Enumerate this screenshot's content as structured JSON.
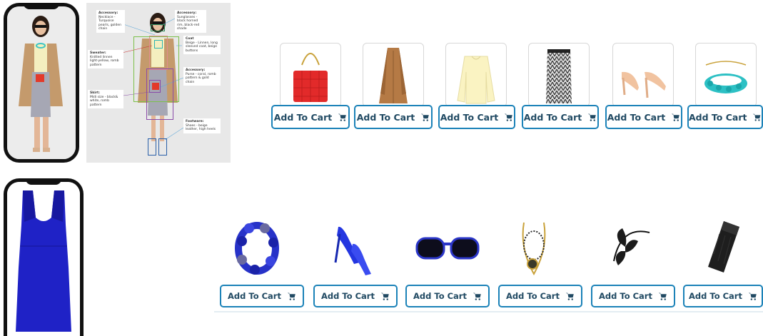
{
  "annotations": {
    "accessory_necklace": {
      "title": "Accessory:",
      "text": "Necklace - Turquoise pearls, golden chain"
    },
    "accessory_sunglasses": {
      "title": "Accessory:",
      "text": "Sunglasses - black horned rim, black-red shade"
    },
    "sweater": {
      "title": "Sweater:",
      "text": "Knitted linnen light-yellow, romb pattern"
    },
    "coat": {
      "title": "Coat",
      "text": "Beige - Linnen, long sleeved coat, beige buttons"
    },
    "accessory_purse": {
      "title": "Accessory:",
      "text": "Purse - coral, romb pattern & gold chain"
    },
    "skirt": {
      "title": "Skirt:",
      "text": "Midi size - black& white, romb pattern"
    },
    "footware": {
      "title": "Footware:",
      "text": "Shoes - beige leather, high heels"
    }
  },
  "row1": {
    "products": [
      {
        "name": "red quilted handbag",
        "button": "Add To Cart"
      },
      {
        "name": "camel coat",
        "button": "Add To Cart"
      },
      {
        "name": "yellow sweater",
        "button": "Add To Cart"
      },
      {
        "name": "black-white pencil skirt",
        "button": "Add To Cart"
      },
      {
        "name": "beige high heels",
        "button": "Add To Cart"
      },
      {
        "name": "turquoise necklace",
        "button": "Add To Cart"
      }
    ]
  },
  "row2": {
    "products": [
      {
        "name": "blue jewel bracelet",
        "button": "Add To Cart"
      },
      {
        "name": "blue high heels",
        "button": "Add To Cart"
      },
      {
        "name": "blue sunglasses",
        "button": "Add To Cart"
      },
      {
        "name": "gold pendant necklace",
        "button": "Add To Cart"
      },
      {
        "name": "black feather headband",
        "button": "Add To Cart"
      },
      {
        "name": "black clutch",
        "button": "Add To Cart"
      }
    ]
  },
  "colors": {
    "accent": "#1b82b8",
    "button_text": "#214a63",
    "dress": "#1f22c6"
  },
  "icons": {
    "cart": "cart-icon"
  }
}
